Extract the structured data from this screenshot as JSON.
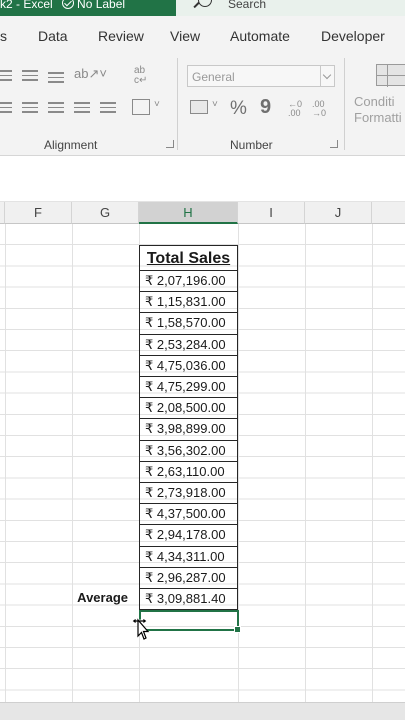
{
  "titlebar": {
    "title_left": "k2  -  Excel",
    "label": "No Label",
    "search_placeholder": "Search"
  },
  "tabs": [
    {
      "label": "s"
    },
    {
      "label": "Data"
    },
    {
      "label": "Review"
    },
    {
      "label": "View"
    },
    {
      "label": "Automate"
    },
    {
      "label": "Developer"
    }
  ],
  "ribbon": {
    "alignment_group": "Alignment",
    "number_group": "Number",
    "number_format": "General",
    "percent": "%",
    "comma": "9",
    "conditional_line1": "Conditi",
    "conditional_line2": "Formatti"
  },
  "columns": [
    "F",
    "G",
    "H",
    "I",
    "J"
  ],
  "selected_column": "H",
  "table": {
    "header": "Total Sales",
    "values": [
      "₹ 2,07,196.00",
      "₹ 1,15,831.00",
      "₹ 1,58,570.00",
      "₹ 2,53,284.00",
      "₹ 4,75,036.00",
      "₹ 4,75,299.00",
      "₹ 2,08,500.00",
      "₹ 3,98,899.00",
      "₹ 3,56,302.00",
      "₹ 2,63,110.00",
      "₹ 2,73,918.00",
      "₹ 4,37,500.00",
      "₹ 2,94,178.00",
      "₹ 4,34,311.00",
      "₹ 2,96,287.00"
    ],
    "average_label": "Average",
    "average_value": "₹ 3,09,881.40"
  },
  "colors": {
    "excel_green": "#217346",
    "ribbon_bg": "#f3f3f3"
  }
}
